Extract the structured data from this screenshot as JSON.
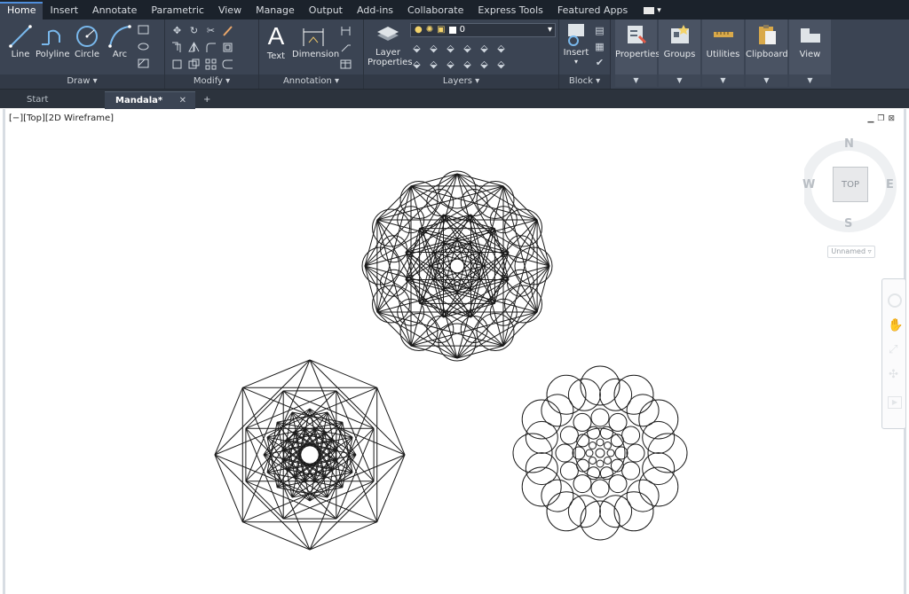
{
  "menu": {
    "tabs": [
      "Home",
      "Insert",
      "Annotate",
      "Parametric",
      "View",
      "Manage",
      "Output",
      "Add-ins",
      "Collaborate",
      "Express Tools",
      "Featured Apps"
    ],
    "active": "Home"
  },
  "ribbon": {
    "draw": {
      "title": "Draw",
      "line": "Line",
      "polyline": "Polyline",
      "circle": "Circle",
      "arc": "Arc"
    },
    "modify": {
      "title": "Modify"
    },
    "annotation": {
      "title": "Annotation",
      "text": "Text",
      "dimension": "Dimension"
    },
    "layers": {
      "title": "Layers",
      "layer_properties_l1": "Layer",
      "layer_properties_l2": "Properties",
      "current_layer": "0"
    },
    "block": {
      "title": "Block",
      "insert": "Insert"
    },
    "properties": "Properties",
    "groups": "Groups",
    "utilities": "Utilities",
    "clipboard": "Clipboard",
    "view": "View"
  },
  "doc_tabs": {
    "start": "Start",
    "mandala": "Mandala*"
  },
  "viewport": {
    "label": "[−][Top][2D Wireframe]",
    "viewcube": {
      "n": "N",
      "s": "S",
      "e": "E",
      "w": "W",
      "face": "TOP",
      "ucs": "Unnamed"
    }
  }
}
